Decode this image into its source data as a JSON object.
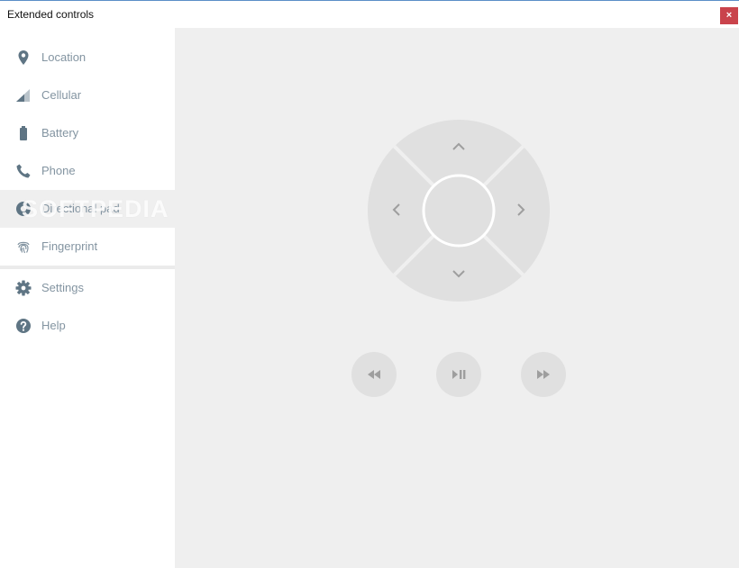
{
  "window": {
    "title": "Extended controls",
    "close_label": "×"
  },
  "sidebar": {
    "items": [
      {
        "label": "Location",
        "icon": "location-pin-icon"
      },
      {
        "label": "Cellular",
        "icon": "cellular-signal-icon"
      },
      {
        "label": "Battery",
        "icon": "battery-icon"
      },
      {
        "label": "Phone",
        "icon": "phone-icon"
      },
      {
        "label": "Directional pad",
        "icon": "dpad-icon",
        "selected": true
      },
      {
        "label": "Fingerprint",
        "icon": "fingerprint-icon"
      },
      {
        "label": "Settings",
        "icon": "gear-icon"
      },
      {
        "label": "Help",
        "icon": "help-icon"
      }
    ],
    "watermark": "SOFTPEDIA"
  },
  "dpad": {
    "buttons": [
      "up",
      "down",
      "left",
      "right",
      "center"
    ]
  },
  "media": {
    "buttons": [
      "rewind",
      "play-pause",
      "fast-forward"
    ]
  },
  "colors": {
    "accent": "#c9434b",
    "icon": "#5f7584",
    "label": "#8394a1",
    "content_bg": "#efefef",
    "button_bg": "#e0e0e0"
  }
}
